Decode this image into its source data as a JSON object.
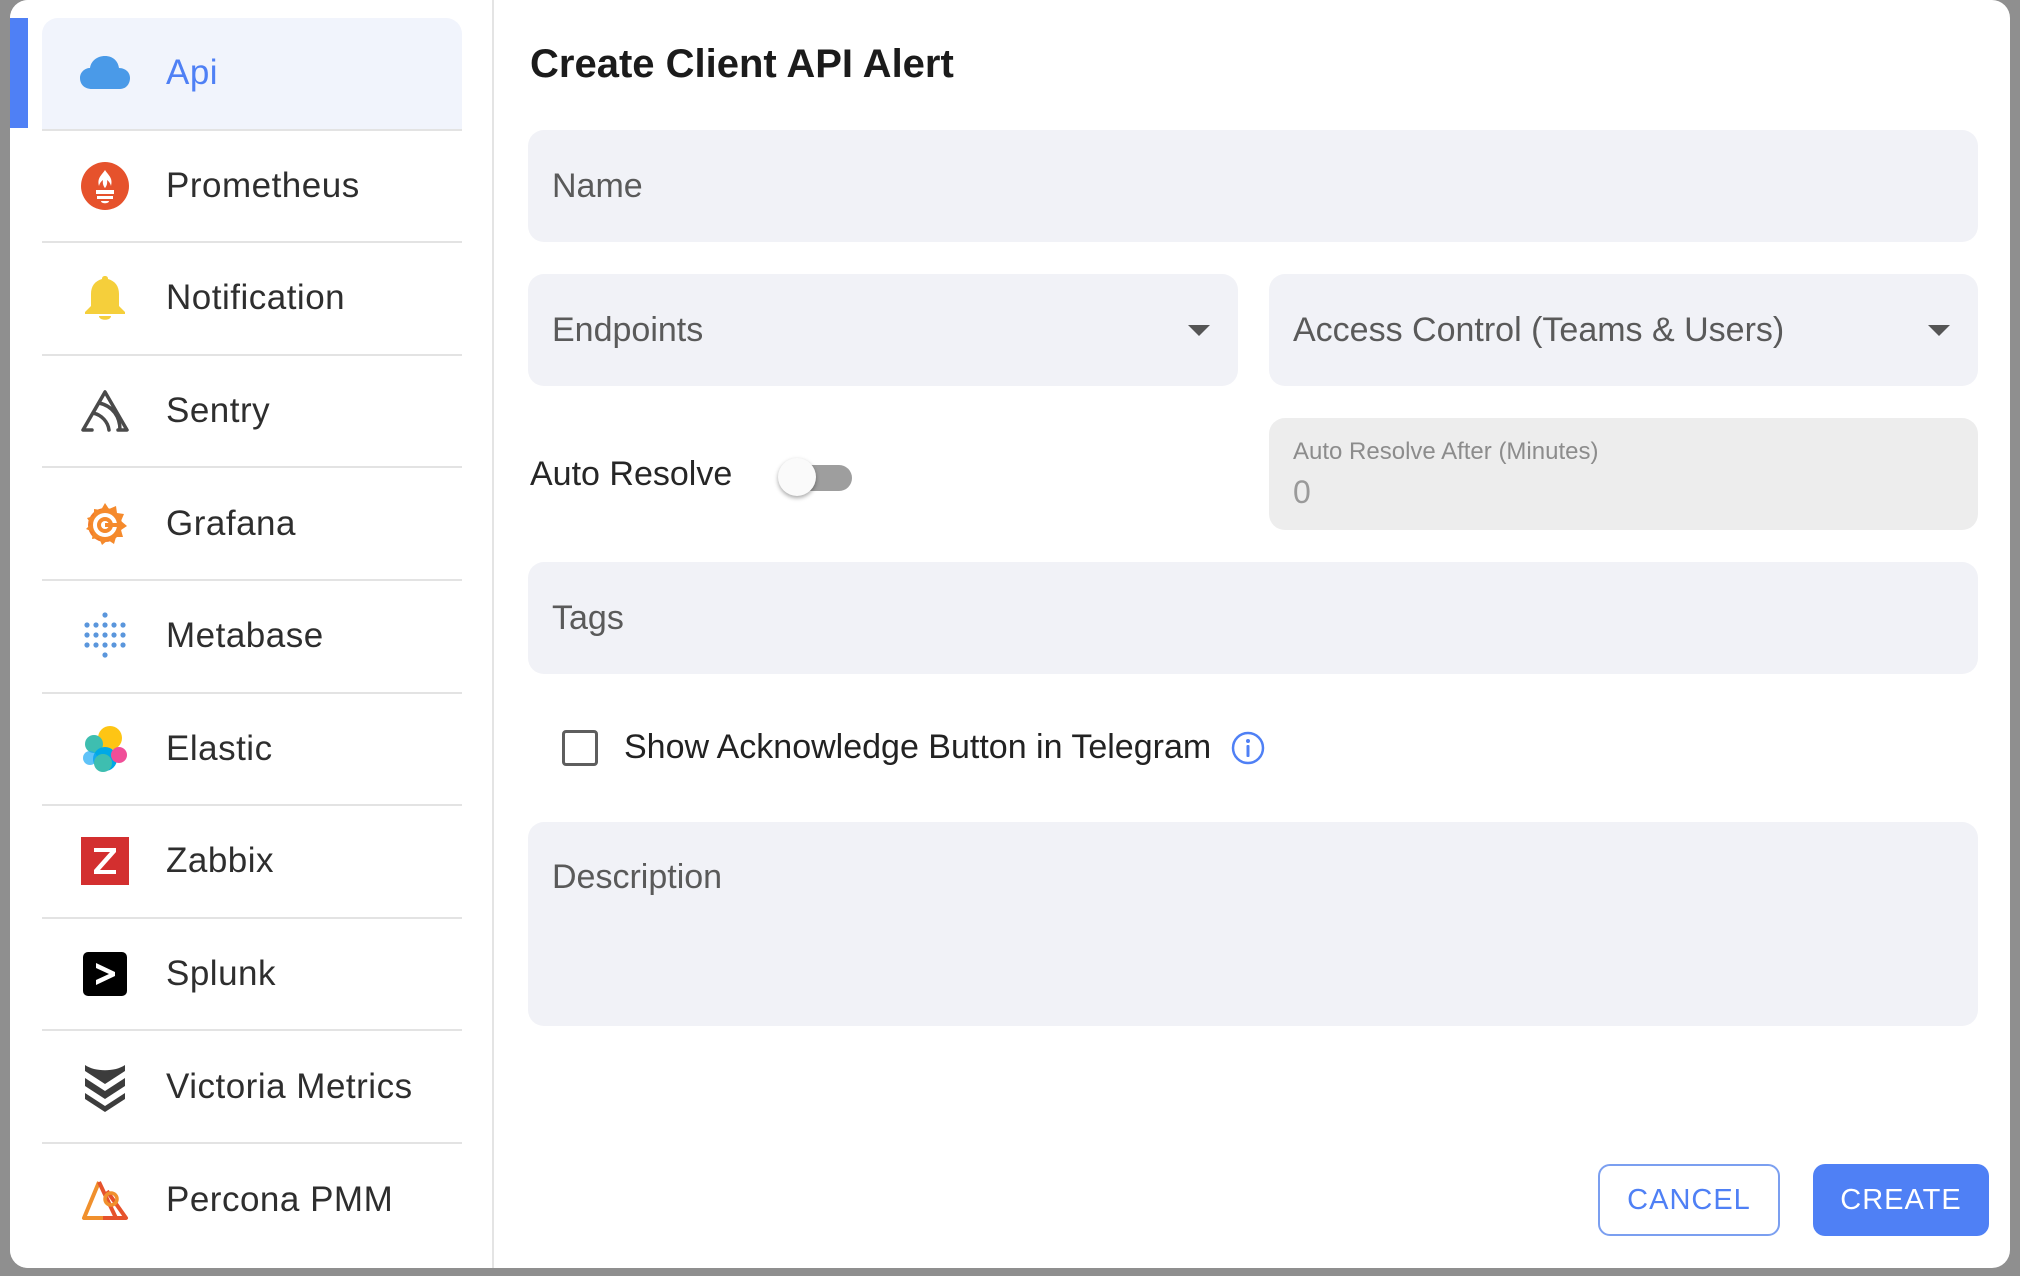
{
  "sidebar": {
    "items": [
      {
        "label": "Api",
        "icon": "cloud-icon",
        "active": true
      },
      {
        "label": "Prometheus",
        "icon": "prometheus-icon"
      },
      {
        "label": "Notification",
        "icon": "bell-icon"
      },
      {
        "label": "Sentry",
        "icon": "sentry-icon"
      },
      {
        "label": "Grafana",
        "icon": "grafana-icon"
      },
      {
        "label": "Metabase",
        "icon": "metabase-icon"
      },
      {
        "label": "Elastic",
        "icon": "elastic-icon"
      },
      {
        "label": "Zabbix",
        "icon": "zabbix-icon"
      },
      {
        "label": "Splunk",
        "icon": "splunk-icon"
      },
      {
        "label": "Victoria Metrics",
        "icon": "victoria-metrics-icon"
      },
      {
        "label": "Percona PMM",
        "icon": "percona-icon"
      }
    ]
  },
  "form": {
    "title": "Create Client API Alert",
    "name_placeholder": "Name",
    "endpoints_placeholder": "Endpoints",
    "access_control_placeholder": "Access Control (Teams & Users)",
    "auto_resolve_label": "Auto Resolve",
    "auto_resolve_enabled": false,
    "auto_resolve_after_label": "Auto Resolve After (Minutes)",
    "auto_resolve_after_value": "0",
    "tags_placeholder": "Tags",
    "telegram_checkbox_label": "Show Acknowledge Button in Telegram",
    "telegram_checkbox_checked": false,
    "description_placeholder": "Description"
  },
  "actions": {
    "cancel_label": "CANCEL",
    "create_label": "CREATE"
  },
  "colors": {
    "accent": "#4f80f5",
    "field_bg": "#f1f2f7"
  }
}
